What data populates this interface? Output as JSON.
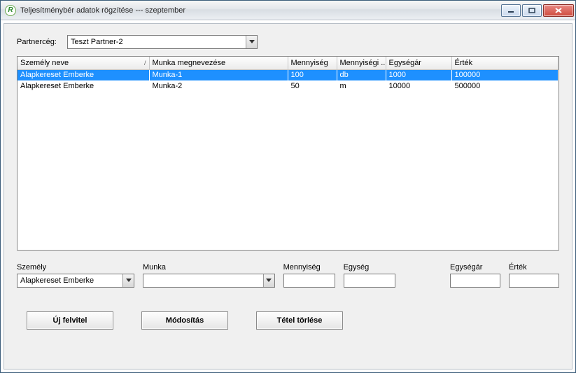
{
  "window": {
    "title": "Teljesítménybér adatok rögzítése --- szeptember"
  },
  "partnerceg": {
    "label": "Partnercég:",
    "value": "Teszt Partner-2"
  },
  "grid": {
    "columns": {
      "name": "Személy neve",
      "work": "Munka megnevezése",
      "qty": "Mennyiség",
      "unit": "Mennyiségi ...",
      "price": "Egységár",
      "value": "Érték"
    },
    "rows": [
      {
        "selected": true,
        "name": "Alapkereset Emberke",
        "work": "Munka-1",
        "qty": "100",
        "unit": "db",
        "price": "1000",
        "value": "100000"
      },
      {
        "selected": false,
        "name": "Alapkereset Emberke",
        "work": "Munka-2",
        "qty": "50",
        "unit": "m",
        "price": "10000",
        "value": "500000"
      }
    ]
  },
  "form": {
    "szemely": {
      "label": "Személy",
      "value": "Alapkereset Emberke"
    },
    "munka": {
      "label": "Munka",
      "value": ""
    },
    "mennyiseg": {
      "label": "Mennyiség",
      "value": ""
    },
    "egyseg": {
      "label": "Egység",
      "value": ""
    },
    "egysegar": {
      "label": "Egységár",
      "value": ""
    },
    "ertek": {
      "label": "Érték",
      "value": ""
    }
  },
  "buttons": {
    "uj": "Új felvitel",
    "modositas": "Módosítás",
    "torles": "Tétel törlése"
  }
}
